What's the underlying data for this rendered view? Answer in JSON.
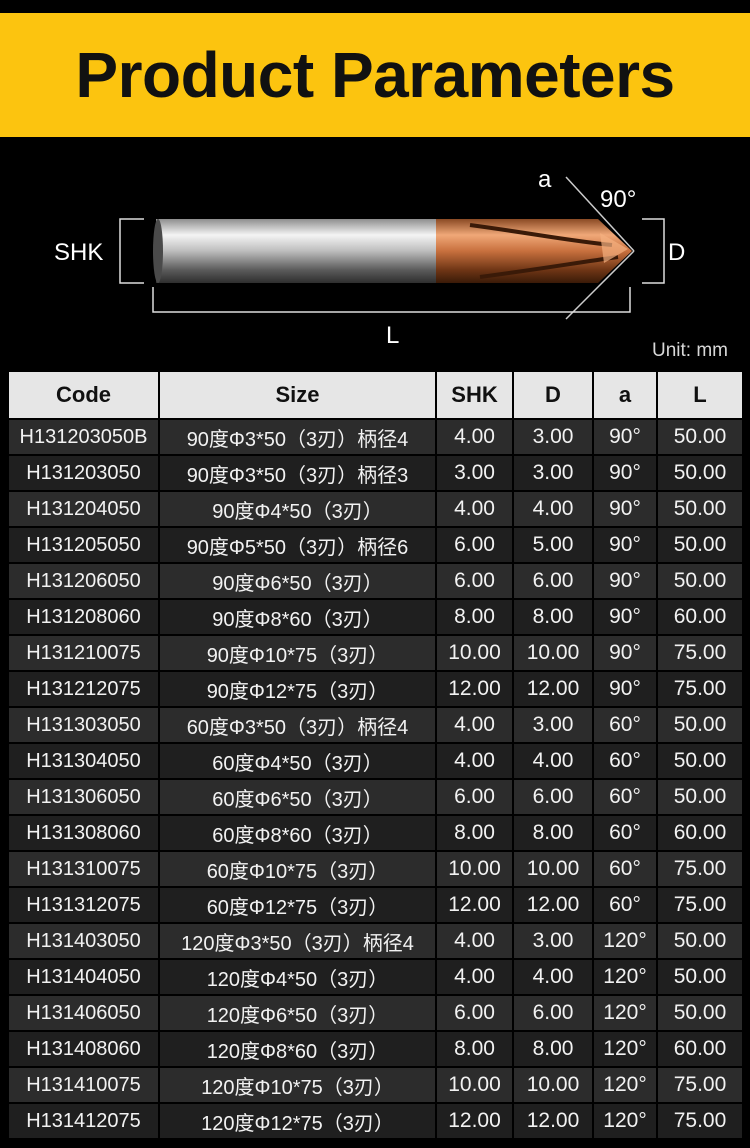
{
  "header": {
    "title": "Product Parameters"
  },
  "diagram": {
    "label_a": "a",
    "label_angle": "90°",
    "label_shk": "SHK",
    "label_d": "D",
    "label_l": "L"
  },
  "unit_label": "Unit: mm",
  "colors": {
    "banner": "#fcc40f",
    "coating": "#c8703e",
    "shank": "#c9c9c9"
  },
  "table": {
    "headers": {
      "code": "Code",
      "size": "Size",
      "shk": "SHK",
      "d": "D",
      "a": "a",
      "l": "L"
    },
    "rows": [
      {
        "code": "H131203050B",
        "size": "90度Φ3*50（3刃）柄径4",
        "shk": "4.00",
        "d": "3.00",
        "a": "90°",
        "l": "50.00"
      },
      {
        "code": "H131203050",
        "size": "90度Φ3*50（3刃）柄径3",
        "shk": "3.00",
        "d": "3.00",
        "a": "90°",
        "l": "50.00"
      },
      {
        "code": "H131204050",
        "size": "90度Φ4*50（3刃）",
        "shk": "4.00",
        "d": "4.00",
        "a": "90°",
        "l": "50.00"
      },
      {
        "code": "H131205050",
        "size": "90度Φ5*50（3刃）柄径6",
        "shk": "6.00",
        "d": "5.00",
        "a": "90°",
        "l": "50.00"
      },
      {
        "code": "H131206050",
        "size": "90度Φ6*50（3刃）",
        "shk": "6.00",
        "d": "6.00",
        "a": "90°",
        "l": "50.00"
      },
      {
        "code": "H131208060",
        "size": "90度Φ8*60（3刃）",
        "shk": "8.00",
        "d": "8.00",
        "a": "90°",
        "l": "60.00"
      },
      {
        "code": "H131210075",
        "size": "90度Φ10*75（3刃）",
        "shk": "10.00",
        "d": "10.00",
        "a": "90°",
        "l": "75.00"
      },
      {
        "code": "H131212075",
        "size": "90度Φ12*75（3刃）",
        "shk": "12.00",
        "d": "12.00",
        "a": "90°",
        "l": "75.00"
      },
      {
        "code": "H131303050",
        "size": "60度Φ3*50（3刃）柄径4",
        "shk": "4.00",
        "d": "3.00",
        "a": "60°",
        "l": "50.00"
      },
      {
        "code": "H131304050",
        "size": "60度Φ4*50（3刃）",
        "shk": "4.00",
        "d": "4.00",
        "a": "60°",
        "l": "50.00"
      },
      {
        "code": "H131306050",
        "size": "60度Φ6*50（3刃）",
        "shk": "6.00",
        "d": "6.00",
        "a": "60°",
        "l": "50.00"
      },
      {
        "code": "H131308060",
        "size": "60度Φ8*60（3刃）",
        "shk": "8.00",
        "d": "8.00",
        "a": "60°",
        "l": "60.00"
      },
      {
        "code": "H131310075",
        "size": "60度Φ10*75（3刃）",
        "shk": "10.00",
        "d": "10.00",
        "a": "60°",
        "l": "75.00"
      },
      {
        "code": "H131312075",
        "size": "60度Φ12*75（3刃）",
        "shk": "12.00",
        "d": "12.00",
        "a": "60°",
        "l": "75.00"
      },
      {
        "code": "H131403050",
        "size": "120度Φ3*50（3刃）柄径4",
        "shk": "4.00",
        "d": "3.00",
        "a": "120°",
        "l": "50.00"
      },
      {
        "code": "H131404050",
        "size": "120度Φ4*50（3刃）",
        "shk": "4.00",
        "d": "4.00",
        "a": "120°",
        "l": "50.00"
      },
      {
        "code": "H131406050",
        "size": "120度Φ6*50（3刃）",
        "shk": "6.00",
        "d": "6.00",
        "a": "120°",
        "l": "50.00"
      },
      {
        "code": "H131408060",
        "size": "120度Φ8*60（3刃）",
        "shk": "8.00",
        "d": "8.00",
        "a": "120°",
        "l": "60.00"
      },
      {
        "code": "H131410075",
        "size": "120度Φ10*75（3刃）",
        "shk": "10.00",
        "d": "10.00",
        "a": "120°",
        "l": "75.00"
      },
      {
        "code": "H131412075",
        "size": "120度Φ12*75（3刃）",
        "shk": "12.00",
        "d": "12.00",
        "a": "120°",
        "l": "75.00"
      }
    ]
  }
}
